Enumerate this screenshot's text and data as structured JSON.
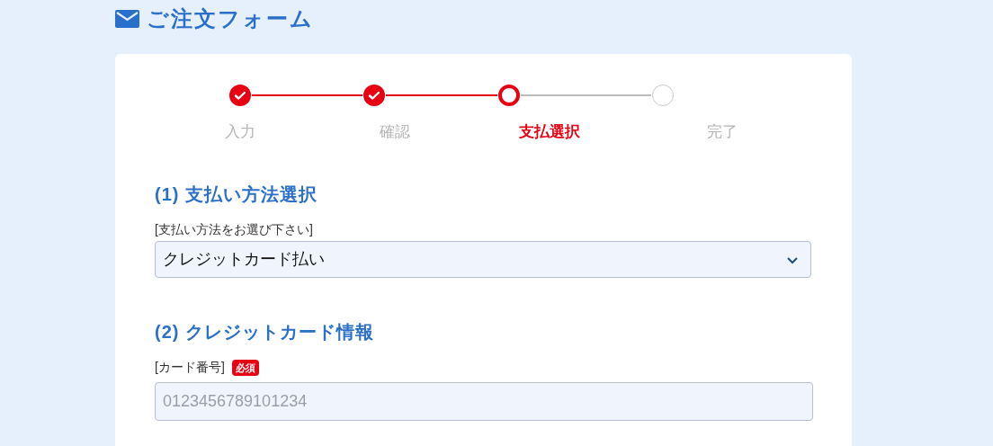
{
  "title": "ご注文フォーム",
  "steps": [
    {
      "label": "入力",
      "kind": "done"
    },
    {
      "label": "確認",
      "kind": "done"
    },
    {
      "label": "支払選択",
      "kind": "current"
    },
    {
      "label": "完了",
      "kind": "todo"
    }
  ],
  "sections": [
    {
      "heading": "(1) 支払い方法選択",
      "field_label": "[支払い方法をお選び下さい]",
      "kind": "select",
      "value": "クレジットカード払い"
    },
    {
      "heading": "(2) クレジットカード情報",
      "field_label": "[カード番号]",
      "required_badge": "必須",
      "kind": "input",
      "placeholder": "0123456789101234"
    }
  ]
}
